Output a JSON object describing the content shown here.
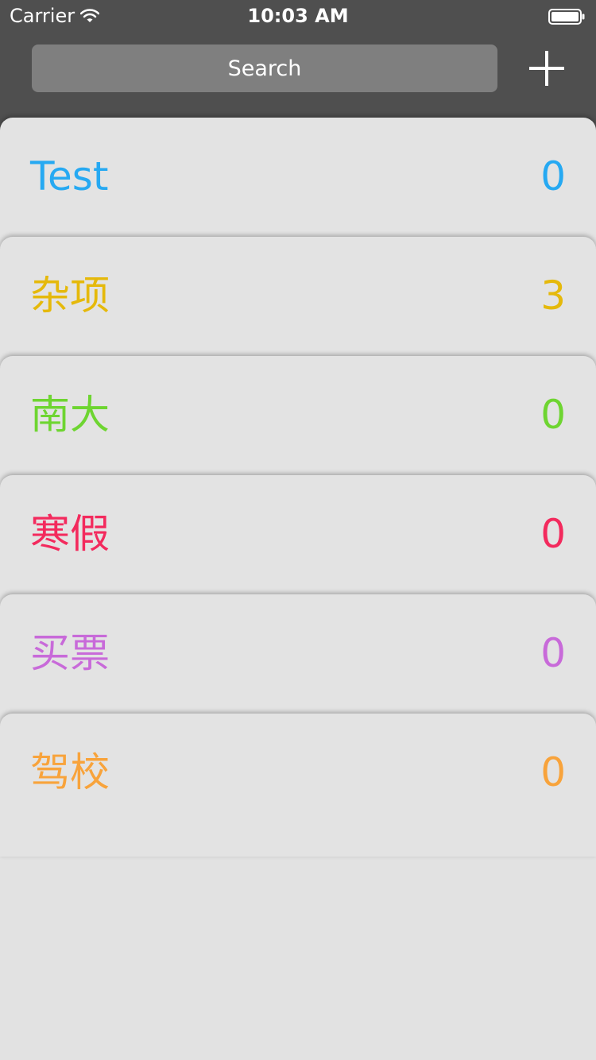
{
  "status_bar": {
    "carrier": "Carrier",
    "time": "10:03 AM",
    "wifi_icon": "wifi-icon",
    "battery_icon": "battery-icon"
  },
  "search": {
    "placeholder": "Search"
  },
  "add_button": {
    "icon": "plus-icon"
  },
  "lists": [
    {
      "name": "Test",
      "count": "0",
      "color": "#26a9f2"
    },
    {
      "name": "杂项",
      "count": "3",
      "color": "#e5b90b"
    },
    {
      "name": "南大",
      "count": "0",
      "color": "#6ed531"
    },
    {
      "name": "寒假",
      "count": "0",
      "color": "#f32a5d"
    },
    {
      "name": "买票",
      "count": "0",
      "color": "#c86ad9"
    },
    {
      "name": "驾校",
      "count": "0",
      "color": "#f8a33b"
    }
  ]
}
